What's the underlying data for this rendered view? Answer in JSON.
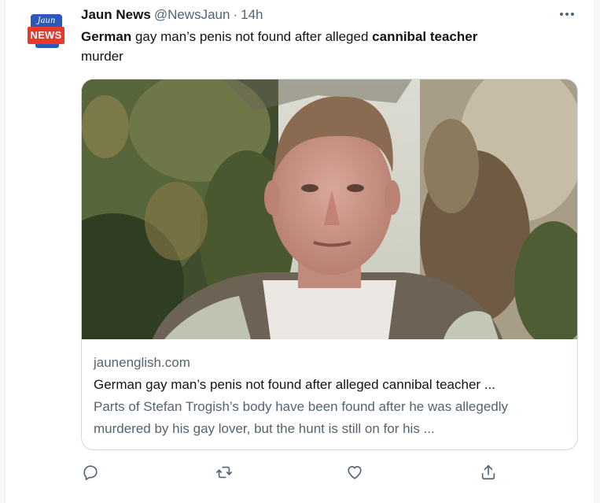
{
  "author": {
    "name": "Jaun News",
    "handle": "@NewsJaun",
    "separator": "·",
    "time": "14h",
    "avatar": {
      "top_text": "Jaun",
      "bottom_text": "NEWS"
    }
  },
  "tweet_text": {
    "part1_bold": "German",
    "part2": " gay man’s penis not found after alleged ",
    "part3_bold": "cannibal teacher",
    "part4": " murder"
  },
  "card": {
    "domain": "jaunenglish.com",
    "title": "German gay man’s penis not found after alleged cannibal teacher ...",
    "description": "Parts of Stefan Trogish’s body have been found after he was allegedly murdered by his gay lover, but the hunt is still on for his ..."
  },
  "actions": {
    "reply": "reply-icon",
    "retweet": "retweet-icon",
    "like": "heart-icon",
    "share": "share-icon"
  },
  "colors": {
    "text_primary": "#0f1419",
    "text_secondary": "#536471",
    "border": "#cfd9de",
    "avatar_blue": "#2c59b8",
    "avatar_red": "#e8392d"
  }
}
